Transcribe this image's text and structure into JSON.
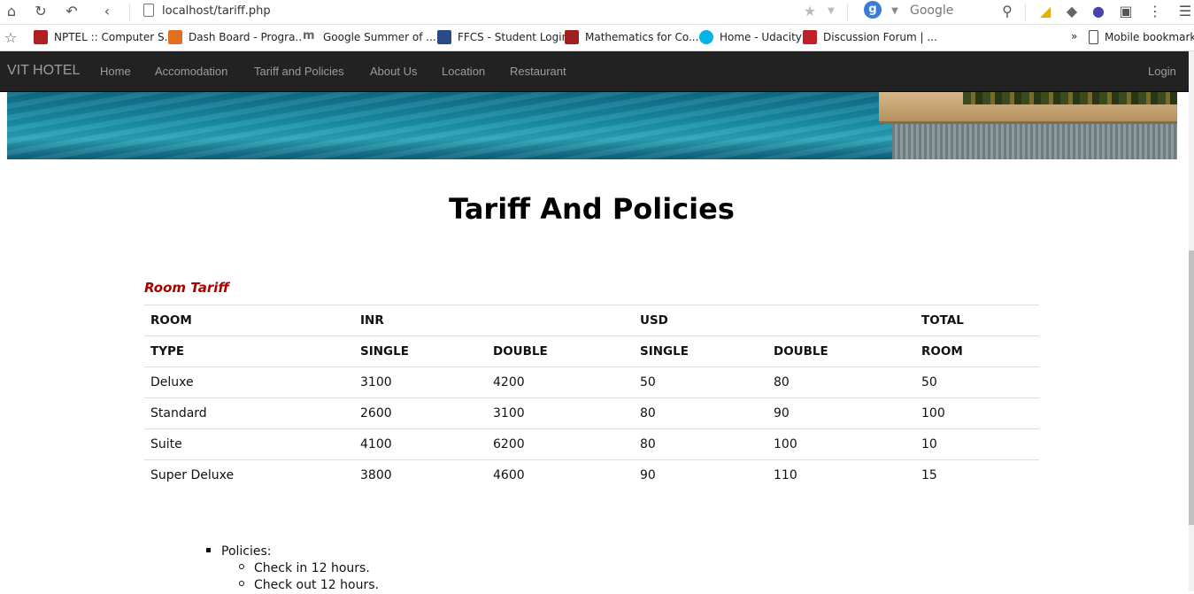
{
  "browser": {
    "url": "localhost/tariff.php",
    "search_engine": "Google",
    "bookmarks": [
      {
        "label": "NPTEL :: Computer S...",
        "color": "#b02020"
      },
      {
        "label": "Dash Board - Progra...",
        "color": "#e07020"
      },
      {
        "label": "Google Summer of ...",
        "color": "#666666"
      },
      {
        "label": "FFCS - Student Login",
        "color": "#2a4a8a"
      },
      {
        "label": "Mathematics for Co...",
        "color": "#a02020"
      },
      {
        "label": "Home - Udacity",
        "color": "#02b3e4"
      },
      {
        "label": "Discussion Forum | ...",
        "color": "#c0202a"
      }
    ],
    "more_bookmarks": "»",
    "mobile_bookmarks": "Mobile bookmark"
  },
  "navbar": {
    "brand": "VIT HOTEL",
    "items": [
      "Home",
      "Accomodation",
      "Tariff and Policies",
      "About Us",
      "Location",
      "Restaurant"
    ],
    "login": "Login"
  },
  "page": {
    "title": "Tariff And Policies",
    "tariff_heading": "Room Tariff"
  },
  "table": {
    "header1": [
      "ROOM",
      "INR",
      "",
      "USD",
      "",
      "TOTAL"
    ],
    "header2": [
      "TYPE",
      "SINGLE",
      "DOUBLE",
      "SINGLE",
      "DOUBLE",
      "ROOM"
    ],
    "rows": [
      [
        "Deluxe",
        "3100",
        "4200",
        "50",
        "80",
        "50"
      ],
      [
        "Standard",
        "2600",
        "3100",
        "80",
        "90",
        "100"
      ],
      [
        "Suite",
        "4100",
        "6200",
        "80",
        "100",
        "10"
      ],
      [
        "Super Deluxe",
        "3800",
        "4600",
        "90",
        "110",
        "15"
      ]
    ]
  },
  "policies": {
    "label": "Policies:",
    "items": [
      "Check in 12 hours.",
      "Check out 12 hours."
    ]
  }
}
